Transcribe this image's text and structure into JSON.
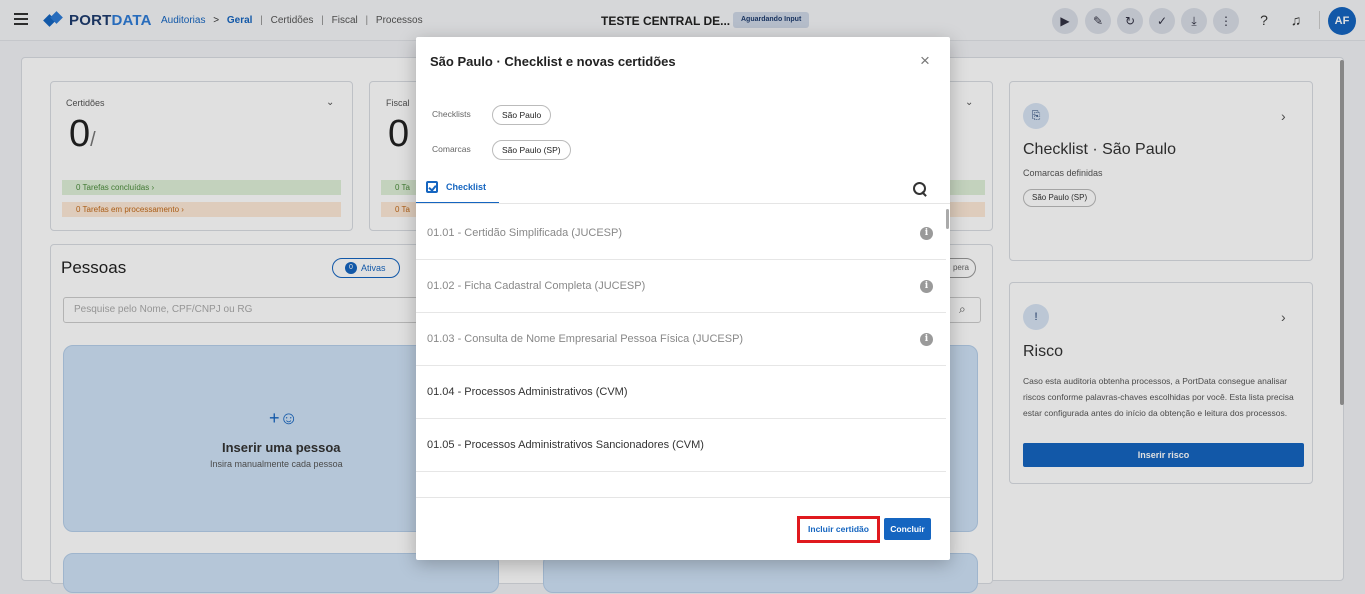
{
  "topbar": {
    "brand": "PORT",
    "brand_accent": "DATA",
    "breadcrumb": {
      "root": "Auditorias",
      "arrow": ">",
      "current": "Geral",
      "items": [
        "Certidões",
        "Fiscal",
        "Processos"
      ],
      "separator": "|"
    },
    "page_name": "TESTE CENTRAL DE...",
    "status": "Aguardando Input",
    "avatar_initials": "AF"
  },
  "background": {
    "card_certidoes": {
      "title": "Certidões",
      "count": "0",
      "count_suffix": "/",
      "tasks_done": "0 Tarefas concluídas",
      "tasks_processing": "0 Tarefas em processamento"
    },
    "card_fiscal": {
      "title": "Fiscal",
      "count": "0",
      "tasks_done": "0 Ta",
      "tasks_processing": "0 Ta"
    },
    "pessoas": {
      "title": "Pessoas",
      "ativas_count": "0",
      "ativas_label": "Ativas",
      "opera_label": "pera",
      "search_placeholder": "Pesquise pelo Nome, CPF/CNPJ ou RG",
      "insert_title": "Inserir uma pessoa",
      "insert_subtitle": "Insira manualmente cada pessoa"
    },
    "checklist_card": {
      "title": "Checklist · São Paulo",
      "subtitle": "Comarcas definidas",
      "chip": "São Paulo (SP)"
    },
    "risco_card": {
      "title": "Risco",
      "description": "Caso esta auditoria obtenha processos, a PortData consegue analisar riscos conforme palavras-chaves escolhidas por você. Esta lista precisa estar configurada antes do início da obtenção e leitura dos processos.",
      "button": "Inserir risco"
    }
  },
  "modal": {
    "title": "São Paulo · Checklist e novas certidões",
    "close": "×",
    "checklists_label": "Checklists",
    "checklists_chip": "São Paulo",
    "comarcas_label": "Comarcas",
    "comarcas_chip": "São Paulo (SP)",
    "tab_label": "Checklist",
    "items": [
      {
        "label": "01.01 - Certidão Simplificada (JUCESP)",
        "disabled": true
      },
      {
        "label": "01.02 - Ficha Cadastral Completa (JUCESP)",
        "disabled": true
      },
      {
        "label": "01.03 - Consulta de Nome Empresarial Pessoa Física (JUCESP)",
        "disabled": true
      },
      {
        "label": "01.04 - Processos Administrativos (CVM)",
        "disabled": false
      },
      {
        "label": "01.05 - Processos Administrativos Sancionadores (CVM)",
        "disabled": false
      }
    ],
    "info_glyph": "i",
    "buttons": {
      "incluir": "Incluir certidão",
      "concluir": "Concluir"
    }
  }
}
